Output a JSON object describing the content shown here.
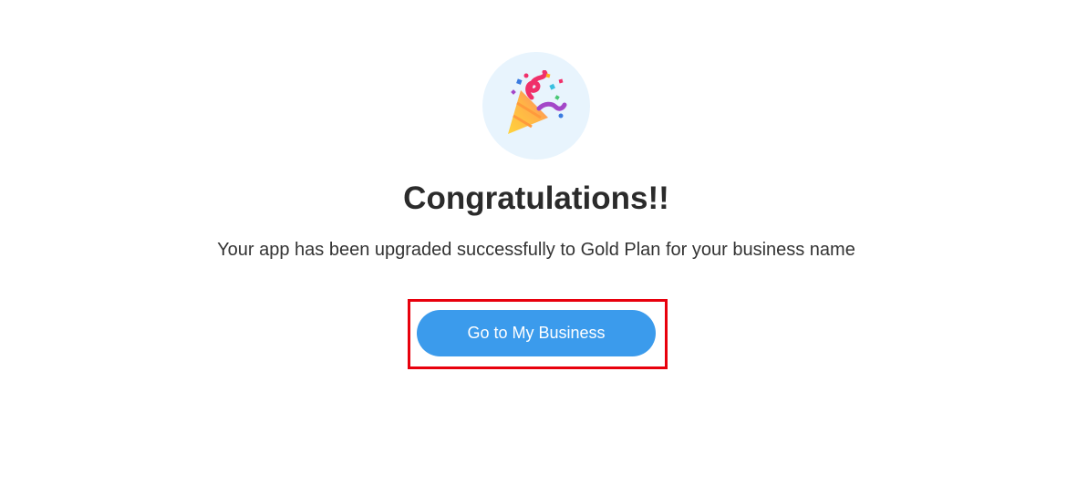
{
  "success": {
    "icon": "party-popper-icon",
    "title": "Congratulations!!",
    "message": "Your app has been upgraded successfully to Gold Plan for your business name",
    "button_label": "Go to My Business"
  },
  "colors": {
    "button_bg": "#3b9bec",
    "icon_bg": "#e8f4fd",
    "highlight": "#e8000d"
  }
}
